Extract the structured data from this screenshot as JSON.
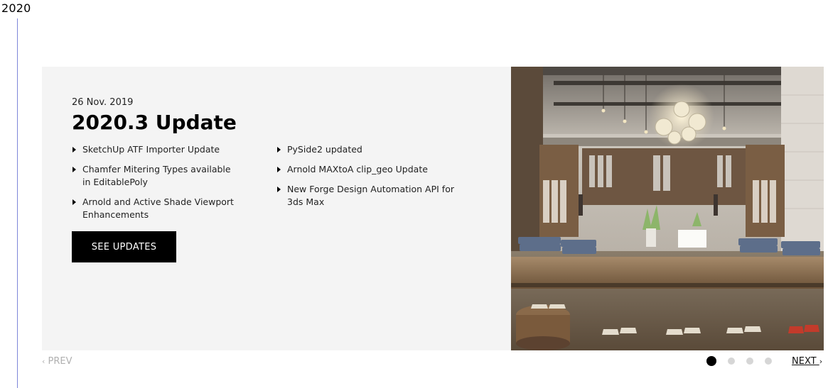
{
  "timeline": {
    "year": "2020"
  },
  "slide": {
    "date": "26 Nov. 2019",
    "title": "2020.3 Update",
    "left_items": [
      "SketchUp ATF Importer Update",
      "Chamfer Mitering Types available in EditablePoly",
      "Arnold and Active Shade Viewport Enhancements"
    ],
    "right_items": [
      "PySide2 updated",
      "Arnold MAXtoA clip_geo Update",
      "New Forge Design Automation API for 3ds Max"
    ],
    "button_label": "SEE UPDATES",
    "image_icon": "retail-store-render-image"
  },
  "pager": {
    "prev_label": "PREV",
    "next_label": "NEXT",
    "total_slides": 4,
    "active_slide": 1
  },
  "colors": {
    "timeline_line": "#7d86d8",
    "card_background": "#f4f4f4",
    "button_background": "#000000",
    "dot_active": "#000000",
    "dot_inactive": "#d6d6d6",
    "prev_disabled": "#b0b0b0"
  }
}
